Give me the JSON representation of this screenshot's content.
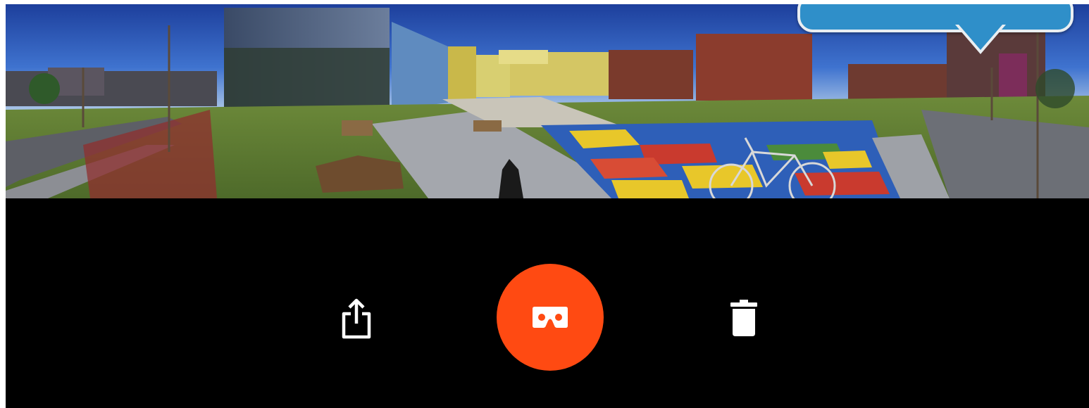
{
  "viewer": {
    "image_description_name": "panorama-photo",
    "tooltip_text": ""
  },
  "toolbar": {
    "share_icon": "share-icon",
    "vr_icon": "vr-headset-icon",
    "delete_icon": "trash-icon"
  },
  "colors": {
    "background": "#000000",
    "vr_button": "#ff4a12",
    "tooltip": "#2f8fc9",
    "tooltip_border": "#e9eef2",
    "icon": "#ffffff"
  }
}
